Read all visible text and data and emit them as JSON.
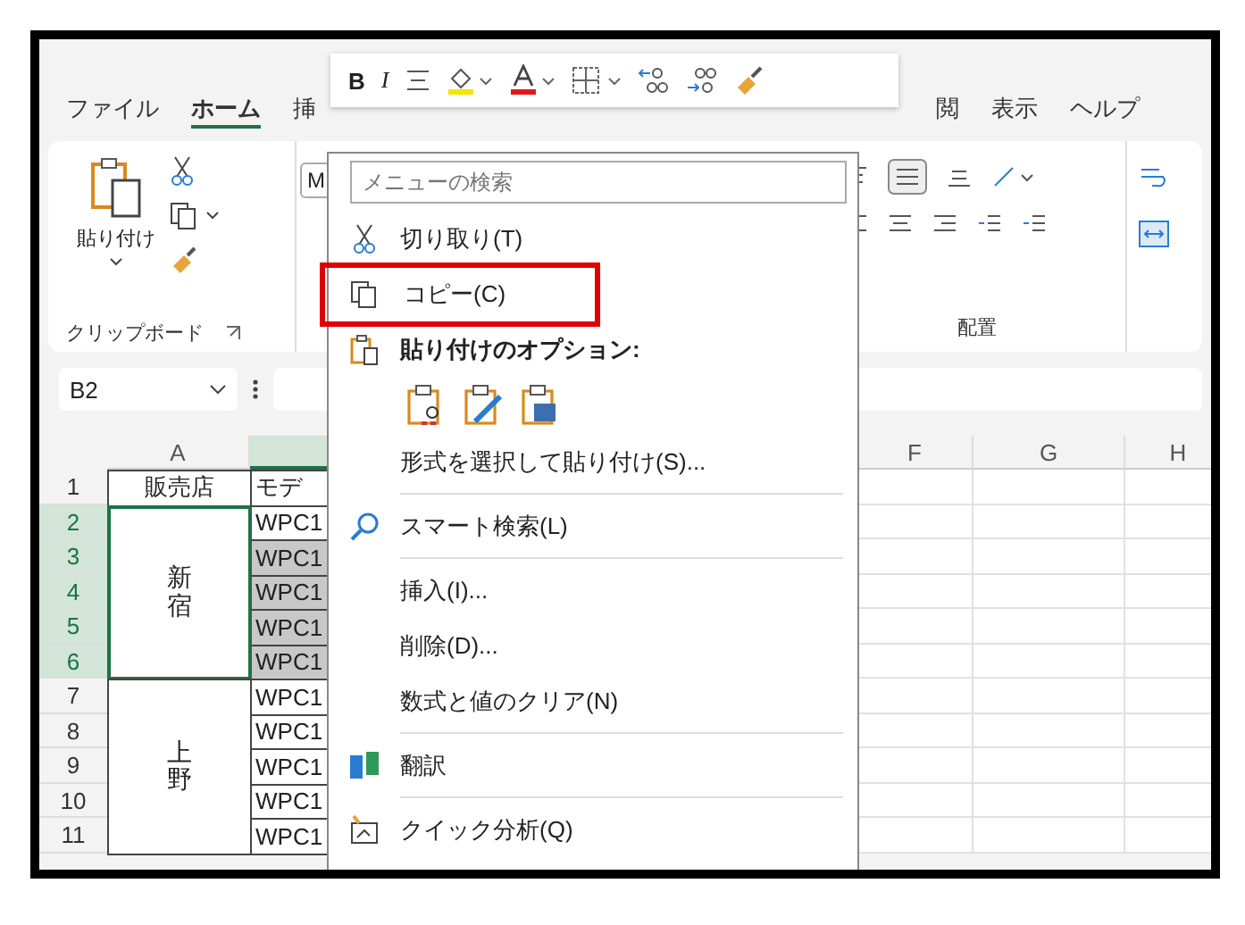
{
  "ribbon_tabs": [
    {
      "label": "ファイル",
      "selected": false
    },
    {
      "label": "ホーム",
      "selected": true
    },
    {
      "label": "挿",
      "selected": false
    },
    {
      "label": "閲",
      "selected": false
    },
    {
      "label": "表示",
      "selected": false
    },
    {
      "label": "ヘルプ",
      "selected": false
    }
  ],
  "clipboard_group": {
    "paste_label": "貼り付け",
    "label": "クリップボード"
  },
  "font_group": {
    "font_field": "M"
  },
  "alignment_group": {
    "label": "配置"
  },
  "name_box": {
    "value": "B2"
  },
  "column_headers": [
    "A",
    "F",
    "G",
    "H"
  ],
  "sheet": {
    "header_row": {
      "number": "1",
      "col_a": "販売店",
      "col_b": "モデ"
    },
    "groups": [
      {
        "store": "新宿",
        "selected": true,
        "rows": [
          {
            "number": "2",
            "col_b": "WPC1",
            "shaded": false
          },
          {
            "number": "3",
            "col_b": "WPC1",
            "shaded": true
          },
          {
            "number": "4",
            "col_b": "WPC1",
            "shaded": true
          },
          {
            "number": "5",
            "col_b": "WPC1",
            "shaded": true
          },
          {
            "number": "6",
            "col_b": "WPC1",
            "shaded": true
          }
        ]
      },
      {
        "store": "上野",
        "selected": false,
        "rows": [
          {
            "number": "7",
            "col_b": "WPC1",
            "shaded": false
          },
          {
            "number": "8",
            "col_b": "WPC1",
            "shaded": false
          },
          {
            "number": "9",
            "col_b": "WPC1",
            "shaded": false
          },
          {
            "number": "10",
            "col_b": "WPC1",
            "shaded": false
          },
          {
            "number": "11",
            "col_b": "WPC1",
            "shaded": false
          }
        ]
      }
    ]
  },
  "mini_toolbar": {
    "bold": "B",
    "italic": "I"
  },
  "context_menu": {
    "search_placeholder": "メニューの検索",
    "items": [
      {
        "kind": "item",
        "label": "切り取り(T)",
        "annotated": false
      },
      {
        "kind": "item",
        "label": "コピー(C)",
        "annotated": true
      },
      {
        "kind": "header",
        "label": "貼り付けのオプション:"
      },
      {
        "kind": "paste_options"
      },
      {
        "kind": "item",
        "label": "形式を選択して貼り付け(S)...",
        "annotated": false
      },
      {
        "kind": "separator"
      },
      {
        "kind": "item",
        "label": "スマート検索(L)",
        "annotated": false
      },
      {
        "kind": "separator"
      },
      {
        "kind": "item",
        "label": "挿入(I)...",
        "annotated": false
      },
      {
        "kind": "item",
        "label": "削除(D)...",
        "annotated": false
      },
      {
        "kind": "item",
        "label": "数式と値のクリア(N)",
        "annotated": false
      },
      {
        "kind": "separator"
      },
      {
        "kind": "item",
        "label": "翻訳",
        "annotated": false
      },
      {
        "kind": "separator"
      },
      {
        "kind": "item",
        "label": "クイック分析(Q)",
        "annotated": false
      }
    ]
  }
}
